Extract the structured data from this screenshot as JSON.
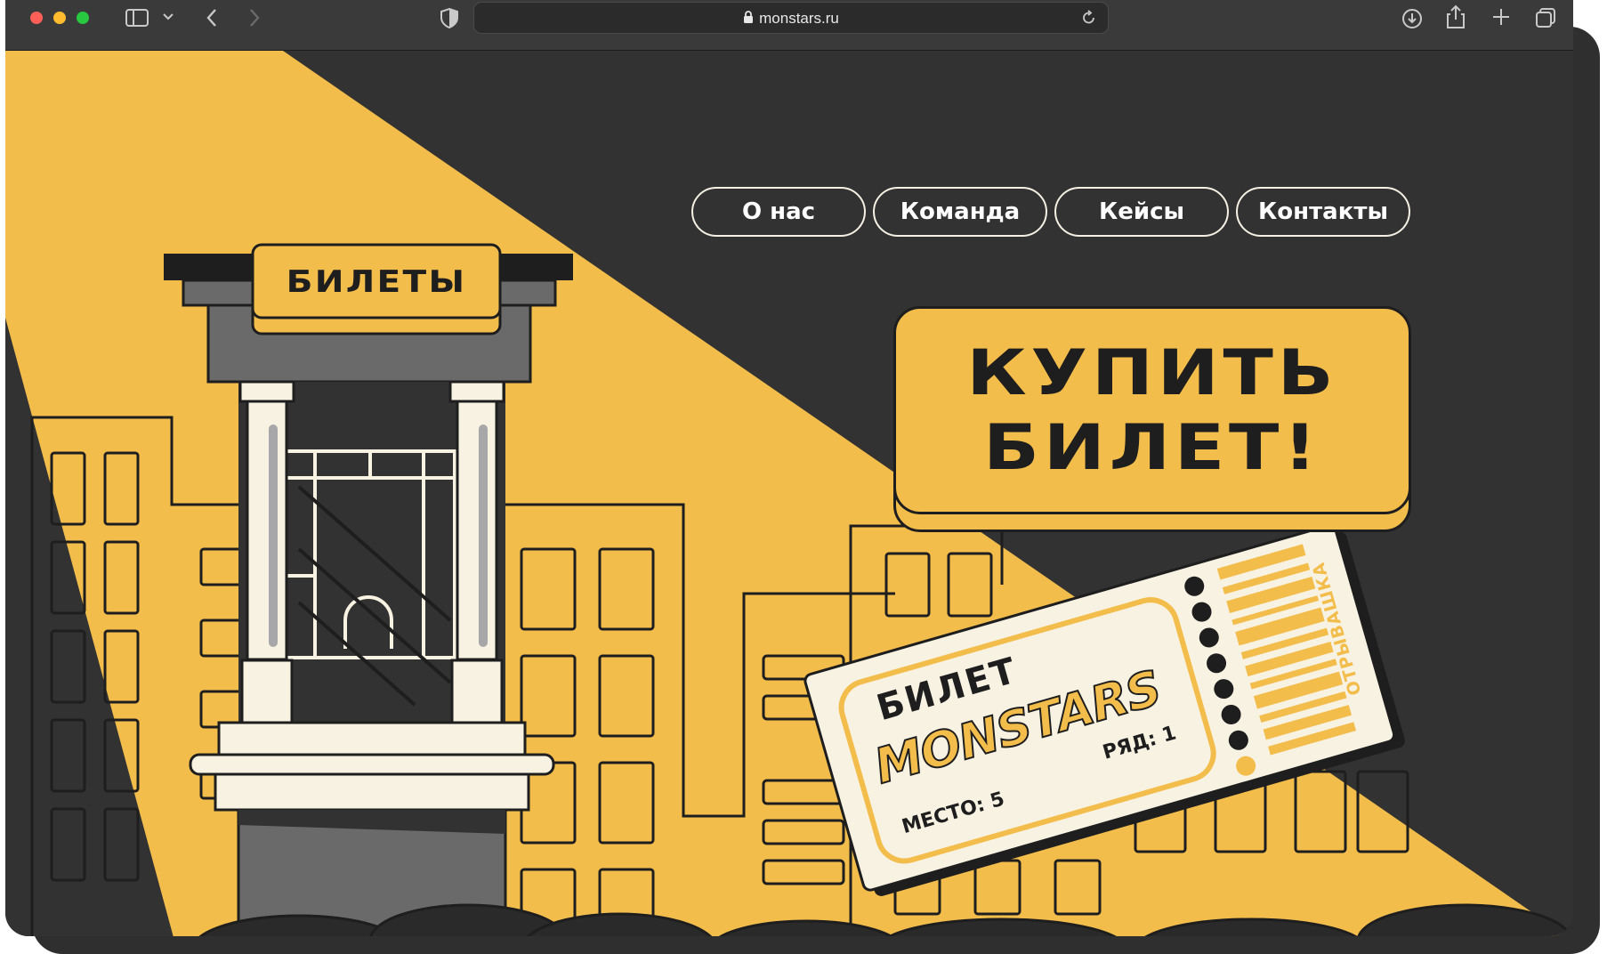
{
  "browser": {
    "url": "monstars.ru"
  },
  "nav": {
    "items": [
      "О нас",
      "Команда",
      "Кейсы",
      "Контакты"
    ]
  },
  "booth": {
    "sign": "БИЛЕТЫ"
  },
  "cta": {
    "line1": "КУПИТЬ",
    "line2": "БИЛЕТ!"
  },
  "ticket": {
    "title": "БИЛЕТ",
    "brand": "MONSTARS",
    "seat": "МЕСТО: 5",
    "row": "РЯД: 1",
    "stub": "ОТРЫВАШКА"
  },
  "colors": {
    "yellow": "#f3bd4c",
    "dark": "#323232",
    "ink": "#1e1e1e",
    "cream": "#f8f2e2"
  }
}
